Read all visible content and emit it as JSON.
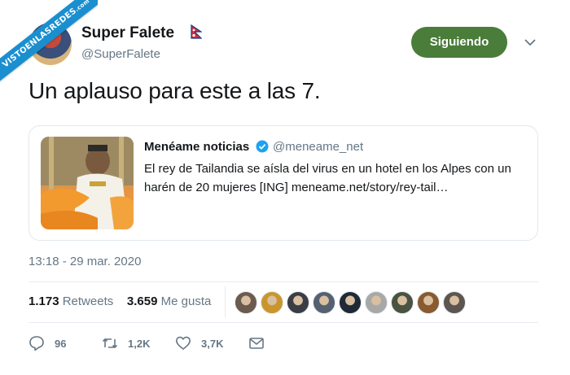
{
  "watermark": {
    "text": "VISTOENLASREDES",
    "suffix": ".com"
  },
  "author": {
    "name": "Super Falete",
    "handle": "@SuperFalete",
    "flag_icon": "nepal-flag-icon"
  },
  "follow_button": {
    "label": "Siguiendo",
    "color": "#4a7c3a"
  },
  "tweet": {
    "text": "Un aplauso para este a las 7."
  },
  "quoted": {
    "name": "Menéame noticias",
    "handle": "@meneame_net",
    "verified_icon": "verified-badge-icon",
    "text": "El rey de Tailandia se aísla del virus en un hotel en los Alpes con un harén de 20 mujeres [ING] meneame.net/story/rey-tail…"
  },
  "timestamp": "13:18 - 29 mar. 2020",
  "stats": {
    "retweets_count": "1.173",
    "retweets_label": "Retweets",
    "likes_count": "3.659",
    "likes_label": "Me gusta"
  },
  "likers": [
    {
      "color": "#6b5a4e"
    },
    {
      "color": "#c9962e"
    },
    {
      "color": "#3b3d44"
    },
    {
      "color": "#556070"
    },
    {
      "color": "#1f2a36"
    },
    {
      "color": "#a8a8a8"
    },
    {
      "color": "#4a5242"
    },
    {
      "color": "#8a5a30"
    },
    {
      "color": "#5c5550"
    }
  ],
  "actions": {
    "reply_count": "96",
    "retweet_count": "1,2K",
    "like_count": "3,7K"
  },
  "colors": {
    "accent_blue": "#1da1f2",
    "secondary_text": "#657786"
  }
}
